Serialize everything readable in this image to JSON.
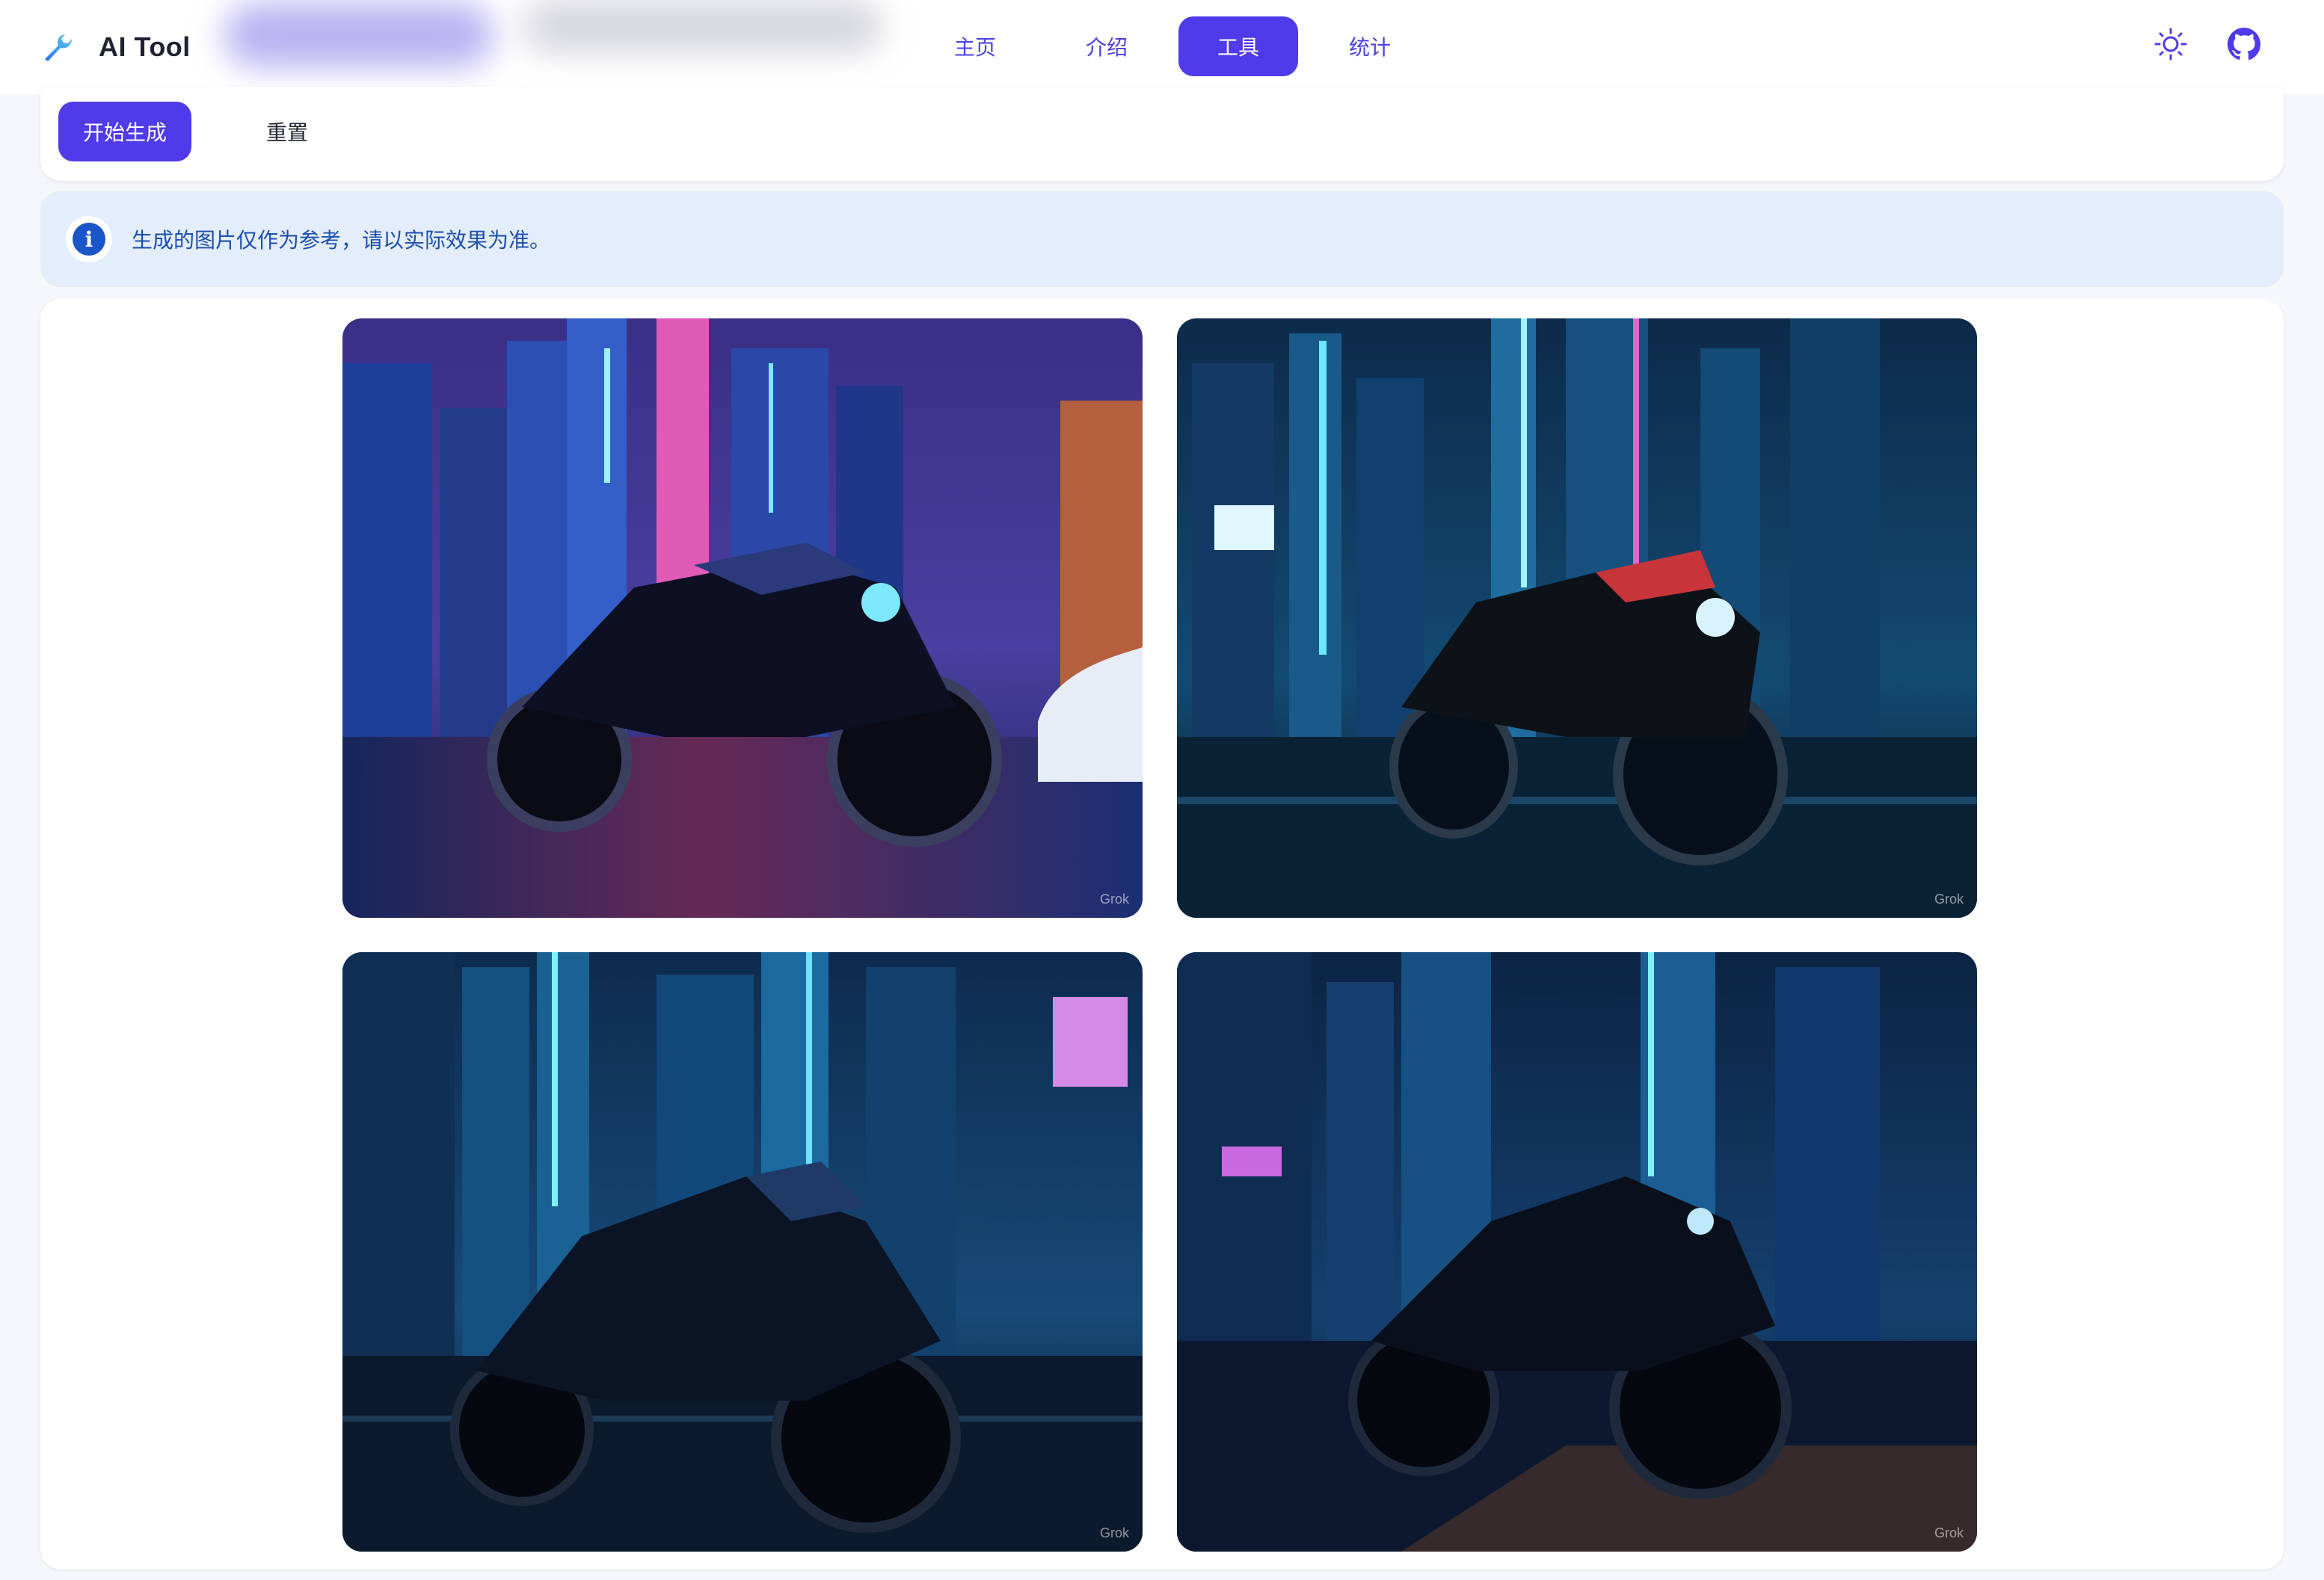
{
  "app": {
    "name": "AI Tool"
  },
  "nav": {
    "items": [
      {
        "label": "主页",
        "active": false
      },
      {
        "label": "介绍",
        "active": false
      },
      {
        "label": "工具",
        "active": true
      },
      {
        "label": "统计",
        "active": false
      }
    ]
  },
  "top_actions": {
    "theme_icon": "sun-icon",
    "github_icon": "github-icon"
  },
  "controls": {
    "generate_label": "开始生成",
    "reset_label": "重置"
  },
  "info": {
    "icon": "info-icon",
    "message": "生成的图片仅作为参考，请以实际效果为准。"
  },
  "gallery": {
    "images": [
      {
        "watermark": "Grok"
      },
      {
        "watermark": "Grok"
      },
      {
        "watermark": "Grok"
      },
      {
        "watermark": "Grok"
      }
    ]
  },
  "colors": {
    "accent": "#4f3bea",
    "info_bg": "#e3edfb",
    "info_text": "#1d4fae"
  }
}
